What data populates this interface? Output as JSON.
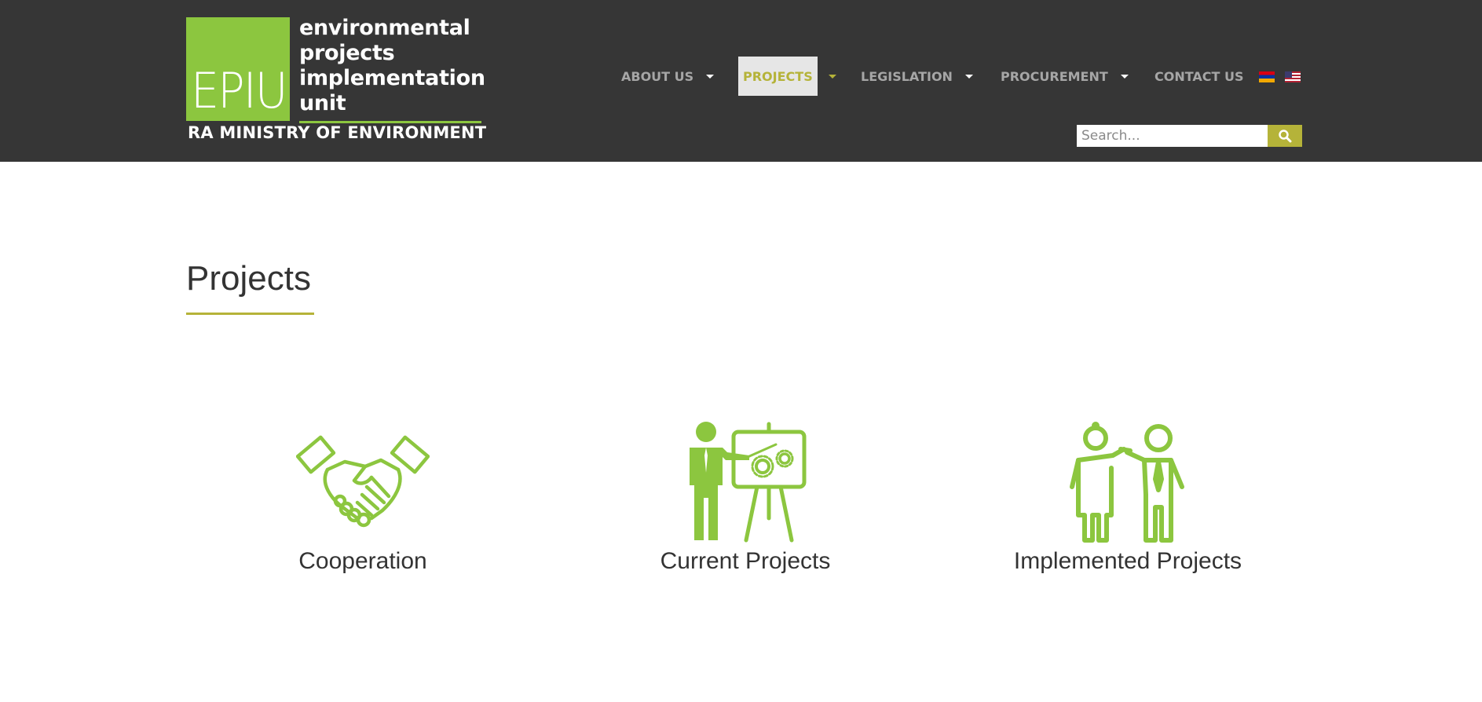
{
  "logo": {
    "mark_text": "EPIU",
    "lines": [
      "environmental",
      "projects",
      "implementation",
      "unit"
    ],
    "ministry": "RA MINISTRY OF ENVIRONMENT"
  },
  "nav": {
    "items": [
      {
        "label": "ABOUT US",
        "has_dropdown": true,
        "active": false
      },
      {
        "label": "PROJECTS",
        "has_dropdown": true,
        "active": true
      },
      {
        "label": "LEGISLATION",
        "has_dropdown": true,
        "active": false
      },
      {
        "label": "PROCUREMENT",
        "has_dropdown": true,
        "active": false
      },
      {
        "label": "CONTACT US",
        "has_dropdown": false,
        "active": false
      }
    ],
    "languages": [
      {
        "flag": "armenia-flag-icon"
      },
      {
        "flag": "us-flag-icon"
      }
    ]
  },
  "search": {
    "placeholder": "Search...",
    "value": "",
    "button_icon": "search-icon"
  },
  "main": {
    "title": "Projects",
    "cards": [
      {
        "label": "Cooperation",
        "icon": "handshake-icon"
      },
      {
        "label": "Current Projects",
        "icon": "presentation-icon"
      },
      {
        "label": "Implemented Projects",
        "icon": "people-icon"
      }
    ]
  },
  "colors": {
    "header_bg": "#363636",
    "brand_green": "#8cc63f",
    "accent_olive": "#b5b339",
    "nav_text": "#a6a6a6",
    "active_bg": "#e6e6e6"
  }
}
